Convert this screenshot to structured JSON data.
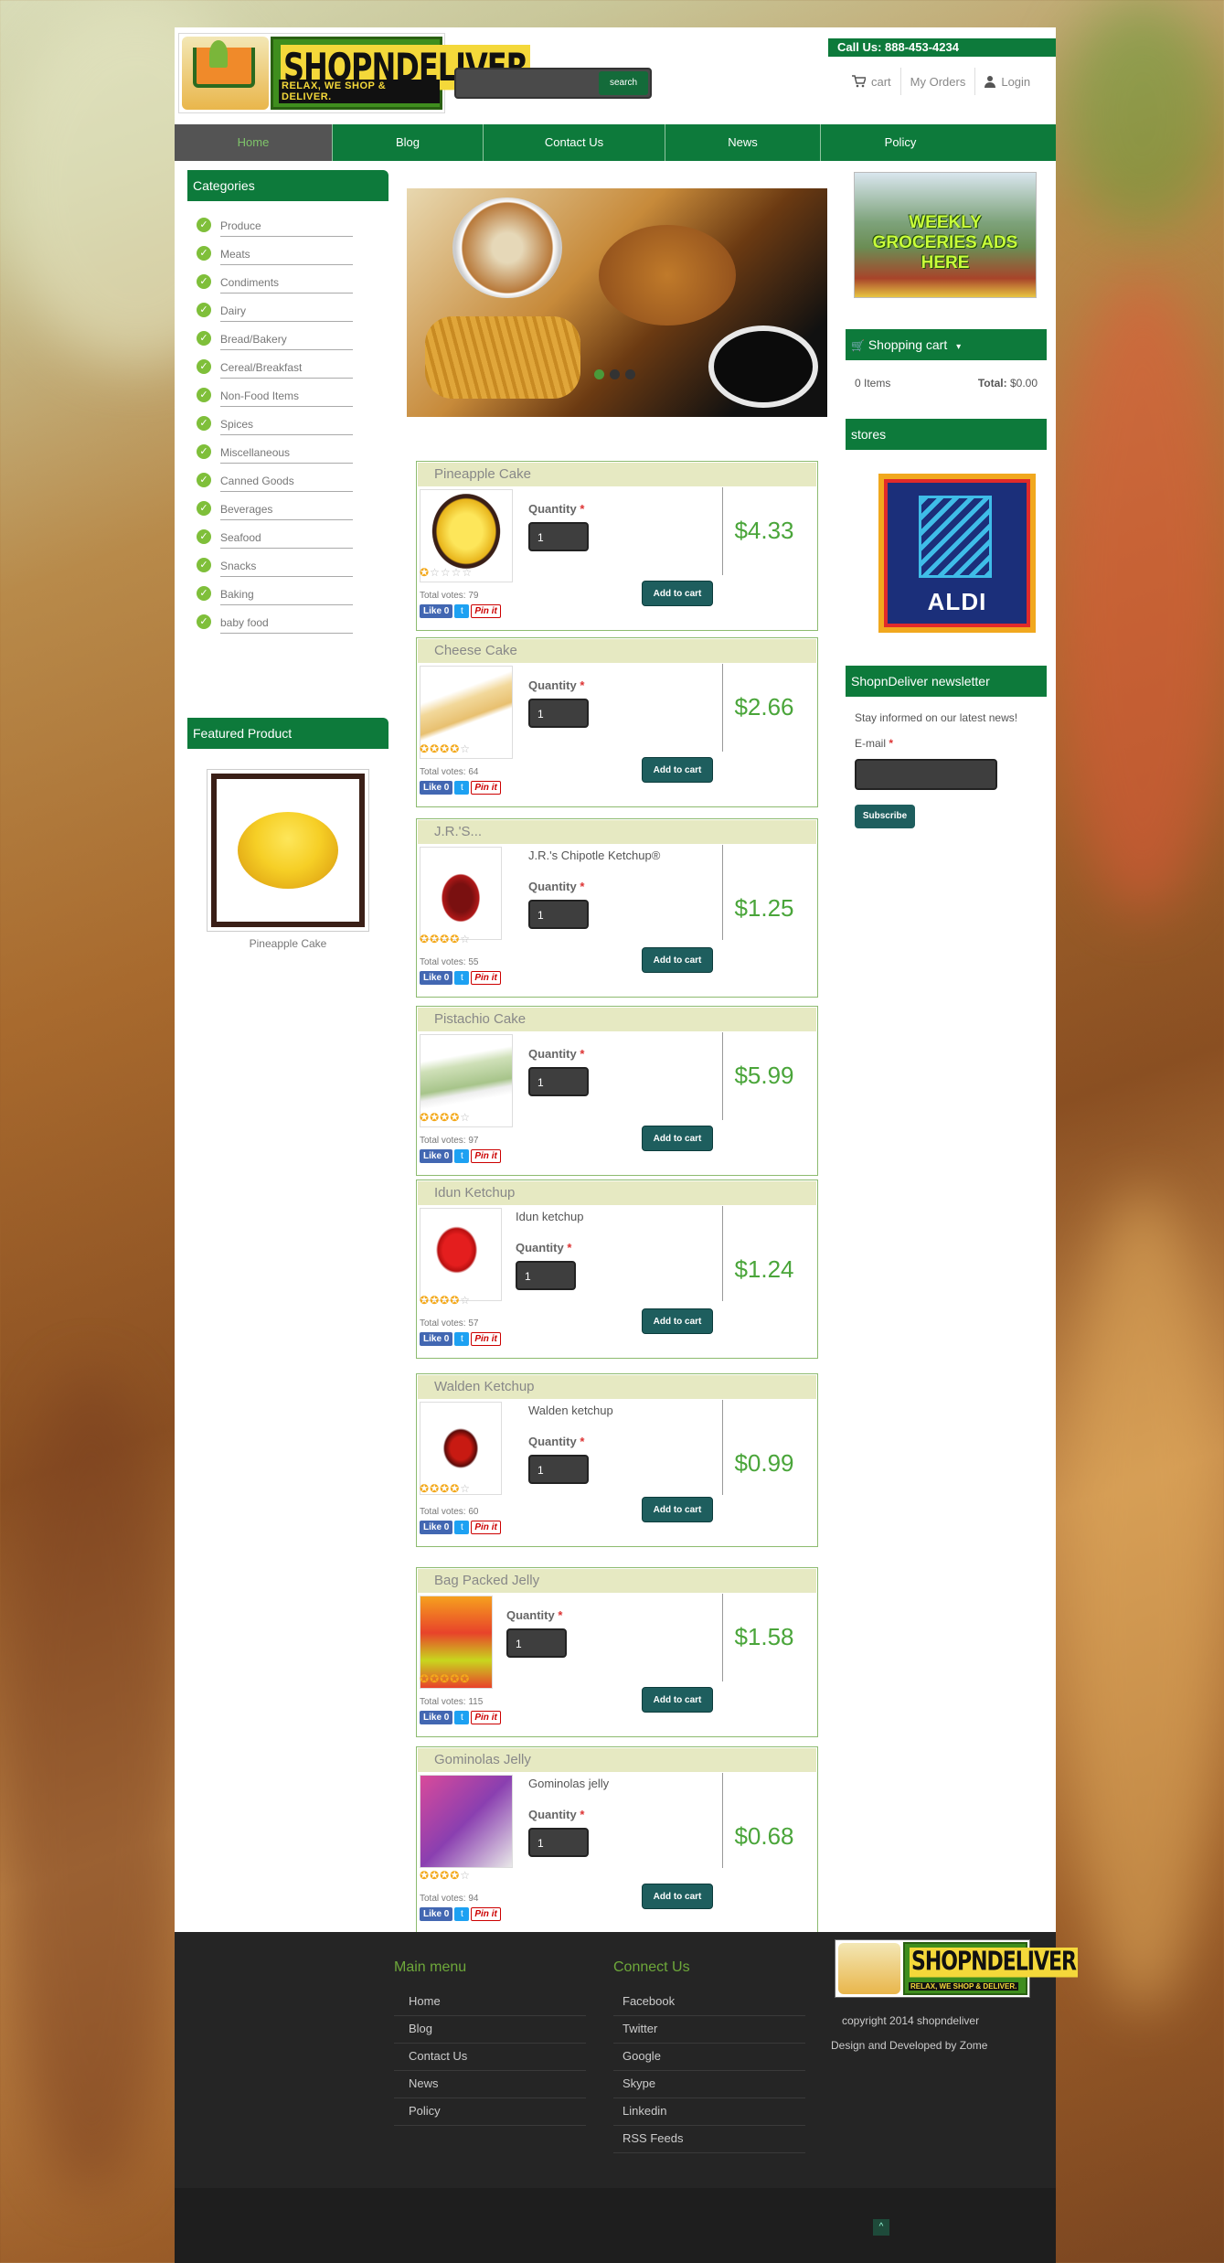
{
  "header": {
    "phone": "Call Us: 888-453-4234",
    "logo": {
      "name": "SHOPNDELIVER",
      "tagline": "RELAX, WE SHOP & DELIVER."
    },
    "search": {
      "button": "search",
      "placeholder": ""
    },
    "links": {
      "cart": "cart",
      "orders": "My Orders",
      "login": "Login"
    }
  },
  "nav": [
    "Home",
    "Blog",
    "Contact Us",
    "News",
    "Policy"
  ],
  "categories": {
    "title": "Categories",
    "items": [
      "Produce",
      "Meats",
      "Condiments",
      "Dairy",
      "Bread/Bakery",
      "Cereal/Breakfast",
      "Non-Food Items",
      "Spices",
      "Miscellaneous",
      "Canned Goods",
      "Beverages",
      "Seafood",
      "Snacks",
      "Baking",
      "baby food"
    ]
  },
  "featured": {
    "title": "Featured Product",
    "caption": "Pineapple Cake"
  },
  "products": [
    {
      "name": "Pineapple Cake",
      "desc": "",
      "price": "$4.33",
      "votes": "Total votes: 79",
      "stars": 1
    },
    {
      "name": "Cheese Cake",
      "desc": "",
      "price": "$2.66",
      "votes": "Total votes: 64",
      "stars": 4
    },
    {
      "name": "J.R.'S...",
      "desc": "J.R.'s Chipotle Ketchup®",
      "price": "$1.25",
      "votes": "Total votes: 55",
      "stars": 4
    },
    {
      "name": "Pistachio Cake",
      "desc": "",
      "price": "$5.99",
      "votes": "Total votes: 97",
      "stars": 4
    },
    {
      "name": "Idun Ketchup",
      "desc": "Idun ketchup",
      "price": "$1.24",
      "votes": "Total votes: 57",
      "stars": 4
    },
    {
      "name": "Walden Ketchup",
      "desc": "Walden ketchup",
      "price": "$0.99",
      "votes": "Total votes: 60",
      "stars": 4
    },
    {
      "name": "Bag Packed Jelly",
      "desc": "",
      "price": "$1.58",
      "votes": "Total votes: 115",
      "stars": 5
    },
    {
      "name": "Gominolas Jelly",
      "desc": "Gominolas jelly",
      "price": "$0.68",
      "votes": "Total votes: 94",
      "stars": 4
    }
  ],
  "product_common": {
    "quantity_label": "Quantity",
    "quantity_value": "1",
    "add_label": "Add to cart",
    "like": "Like 0",
    "pin": "Pin it"
  },
  "ads": {
    "text": "WEEKLY GROCERIES ADS HERE"
  },
  "cart": {
    "title": "Shopping cart",
    "items": "0 Items",
    "total_label": "Total:",
    "total": "$0.00"
  },
  "stores": {
    "title": "stores",
    "store_name": "ALDI"
  },
  "newsletter": {
    "title": "ShopnDeliver newsletter",
    "text": "Stay informed on our latest news!",
    "email_label": "E-mail",
    "subscribe": "Subscribe"
  },
  "footer": {
    "main_menu_title": "Main menu",
    "main_menu": [
      "Home",
      "Blog",
      "Contact Us",
      "News",
      "Policy"
    ],
    "connect_title": "Connect Us",
    "connect": [
      "Facebook",
      "Twitter",
      "Google",
      "Skype",
      "Linkedin",
      "RSS Feeds"
    ],
    "copyright": "copyright 2014 shopndeliver",
    "design": "Design and Developed by Zome",
    "to_top": "^"
  },
  "colors": {
    "brand_green": "#0d7a3b",
    "price_green": "#4aa53a",
    "product_header": "#e6e9c2",
    "footer_bg": "#252525"
  }
}
